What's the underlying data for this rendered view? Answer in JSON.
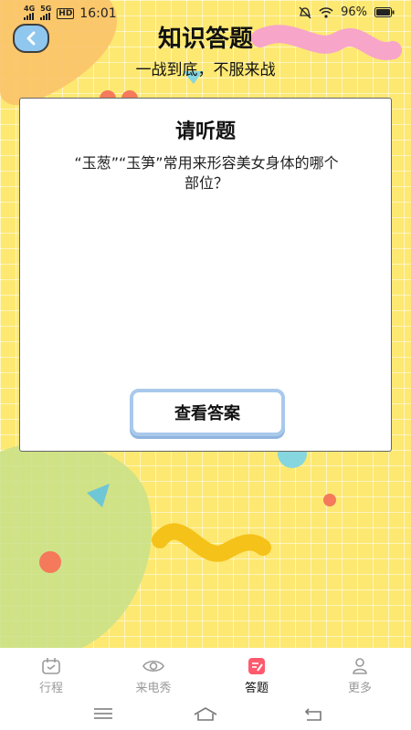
{
  "status_bar": {
    "network_1": "4G",
    "network_2": "5G",
    "hd_label": "HD",
    "time": "16:01",
    "battery": "96%",
    "icons": [
      "mute-icon",
      "wifi-icon",
      "battery-icon"
    ]
  },
  "header": {
    "back_icon": "chevron-left-icon",
    "title": "知识答题",
    "subtitle": "一战到底，不服来战"
  },
  "card": {
    "title": "请听题",
    "question": "“玉葱”“玉笋”常用来形容美女身体的哪个部位？",
    "answer_button": "查看答案"
  },
  "tabs": [
    {
      "label": "行程",
      "icon": "calendar-icon",
      "active": false
    },
    {
      "label": "来电秀",
      "icon": "eye-icon",
      "active": false
    },
    {
      "label": "答题",
      "icon": "pencil-icon",
      "active": true
    },
    {
      "label": "更多",
      "icon": "person-icon",
      "active": false
    }
  ],
  "colors": {
    "background": "#fde872",
    "accent_active": "#ff5a6e",
    "tab_inactive": "#9a9a9a",
    "button_border": "#a9c9ec"
  }
}
